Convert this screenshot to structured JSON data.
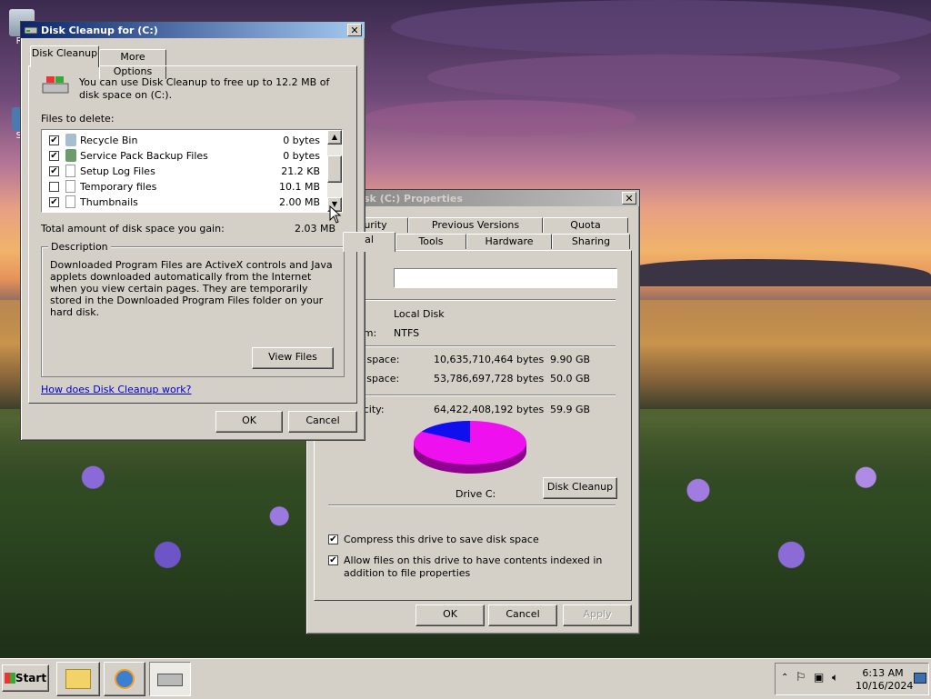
{
  "desktop": {
    "icons": [
      {
        "label": "Re"
      },
      {
        "label": "Su"
      }
    ]
  },
  "cleanup": {
    "title": "Disk Cleanup for  (C:)",
    "tabs": [
      "Disk Cleanup",
      "More Options"
    ],
    "intro": "You can use Disk Cleanup to free up to 12.2 MB of disk space on  (C:).",
    "files_label": "Files to delete:",
    "files": [
      {
        "name": "Recycle Bin",
        "size": "0 bytes",
        "checked": true
      },
      {
        "name": "Service Pack Backup Files",
        "size": "0 bytes",
        "checked": true
      },
      {
        "name": "Setup Log Files",
        "size": "21.2 KB",
        "checked": true
      },
      {
        "name": "Temporary files",
        "size": "10.1 MB",
        "checked": false
      },
      {
        "name": "Thumbnails",
        "size": "2.00 MB",
        "checked": true
      }
    ],
    "total_label": "Total amount of disk space you gain:",
    "total_value": "2.03 MB",
    "description_heading": "Description",
    "description": "Downloaded Program Files are ActiveX controls and Java applets downloaded automatically from the Internet when you view certain pages. They are temporarily stored in the Downloaded Program Files folder on your hard disk.",
    "view_files": "View Files",
    "help_link": "How does Disk Cleanup work?",
    "ok": "OK",
    "cancel": "Cancel"
  },
  "props": {
    "title": "sk (C:) Properties",
    "tabs_back": [
      "urity",
      "Previous Versions",
      "Quota"
    ],
    "tabs_front": [
      "al",
      "Tools",
      "Hardware",
      "Sharing"
    ],
    "label_value": "",
    "type_value": "Local Disk",
    "fs_label": "em:",
    "fs_value": "NTFS",
    "used_label": "d space:",
    "used_bytes": "10,635,710,464 bytes",
    "used_gb": "9.90 GB",
    "free_label": "e space:",
    "free_bytes": "53,786,697,728 bytes",
    "free_gb": "50.0 GB",
    "cap_label": "acity:",
    "cap_bytes": "64,422,408,192 bytes",
    "cap_gb": "59.9 GB",
    "used_fraction": 0.165,
    "used_color": "#1010ee",
    "free_color": "#ee10ee",
    "drive_label": "Drive C:",
    "cleanup_btn": "Disk Cleanup",
    "compress_label": "Compress this drive to save disk space",
    "compress_checked": true,
    "index_label": "Allow files on this drive to have contents indexed in addition to file properties",
    "index_checked": true,
    "ok": "OK",
    "cancel": "Cancel",
    "apply": "Apply"
  },
  "taskbar": {
    "start": "Start",
    "time": "6:13 AM",
    "date": "10/16/2024"
  }
}
